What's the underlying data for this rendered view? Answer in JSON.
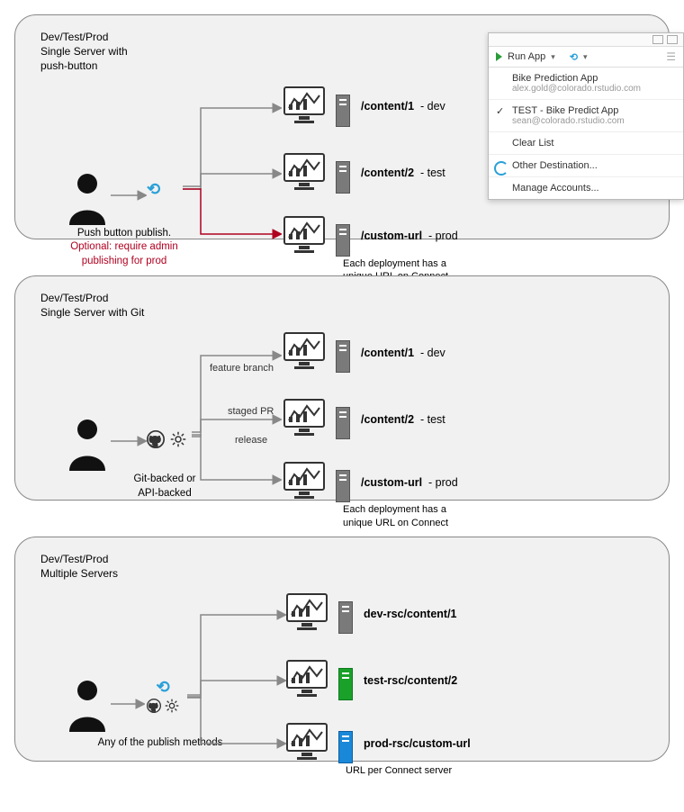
{
  "panels": [
    {
      "title": "Dev/Test/Prod\nSingle Server with\npush-button",
      "caption_main": "Push button publish.",
      "caption_optional": "Optional: require admin publishing for prod",
      "deployments": [
        {
          "url": "/content/1",
          "env": "- dev"
        },
        {
          "url": "/content/2",
          "env": "- test"
        },
        {
          "url": "/custom-url",
          "env": "- prod",
          "note": "Each deployment has a unique URL on Connect"
        }
      ]
    },
    {
      "title": "Dev/Test/Prod\nSingle Server with Git",
      "caption_main": "Git-backed or\nAPI-backed",
      "edges": [
        "feature branch",
        "staged PR",
        "release"
      ],
      "deployments": [
        {
          "url": "/content/1",
          "env": "- dev"
        },
        {
          "url": "/content/2",
          "env": "- test"
        },
        {
          "url": "/custom-url",
          "env": "- prod",
          "note": "Each deployment has a unique URL on Connect"
        }
      ]
    },
    {
      "title": "Dev/Test/Prod\nMultiple Servers",
      "caption_main": "Any of the publish methods",
      "deployments": [
        {
          "url": "dev-rsc/content/1",
          "env": ""
        },
        {
          "url": "test-rsc/content/2",
          "env": ""
        },
        {
          "url": "prod-rsc/custom-url",
          "env": "",
          "note": "URL per Connect server"
        }
      ]
    }
  ],
  "popup": {
    "run_label": "Run App",
    "items": [
      {
        "title": "Bike Prediction App",
        "subtitle": "alex.gold@colorado.rstudio.com"
      },
      {
        "title": "TEST - Bike Predict App",
        "subtitle": "sean@colorado.rstudio.com",
        "checked": true
      },
      {
        "title": "Clear List"
      },
      {
        "title": "Other Destination...",
        "icon": true
      },
      {
        "title": "Manage Accounts..."
      }
    ]
  }
}
